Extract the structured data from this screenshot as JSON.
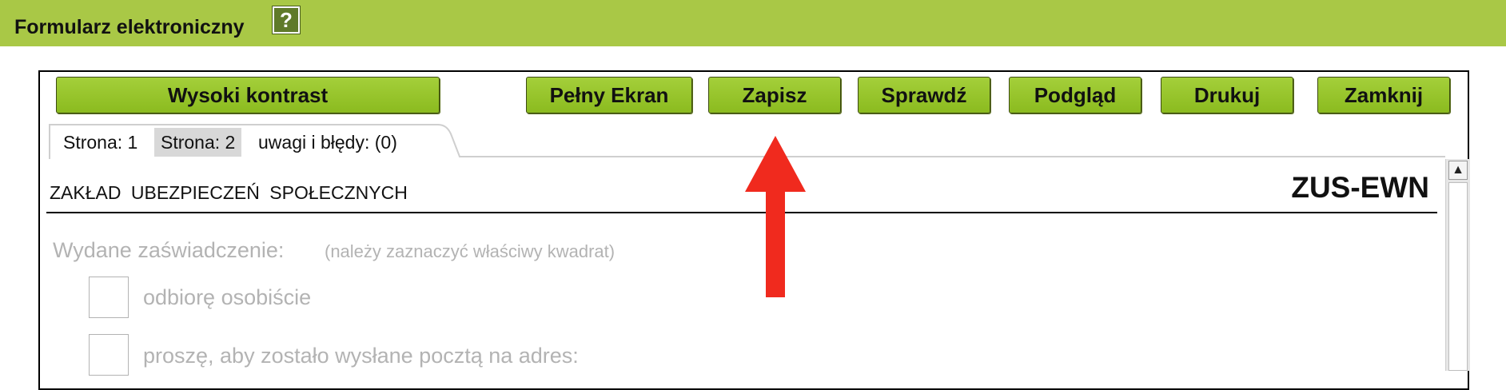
{
  "header": {
    "title": "Formularz elektroniczny",
    "help_icon": "?"
  },
  "toolbar": {
    "high_contrast": "Wysoki kontrast",
    "fullscreen": "Pełny Ekran",
    "save": "Zapisz",
    "check": "Sprawdź",
    "preview": "Podgląd",
    "print": "Drukuj",
    "close": "Zamknij"
  },
  "tabs": [
    "Strona: 1",
    "Strona: 2",
    "uwagi i błędy: (0)"
  ],
  "active_tab": "Strona: 2",
  "form": {
    "agency": "ZAKŁAD UBEZPIECZEŃ SPOŁECZNYCH",
    "code": "ZUS-EWN",
    "field_label": "Wydane zaświadczenie:",
    "field_hint": "(należy zaznaczyć właściwy kwadrat)",
    "options": [
      "odbiorę osobiście",
      "proszę, aby zostało wysłane pocztą na adres:"
    ]
  },
  "colors": {
    "header_bg": "#a9c846",
    "button_bg": "#97c42c",
    "annotation_arrow": "#f02a1e"
  },
  "icons": [
    "help-icon",
    "scroll-up-icon",
    "annotation-arrow-icon"
  ]
}
